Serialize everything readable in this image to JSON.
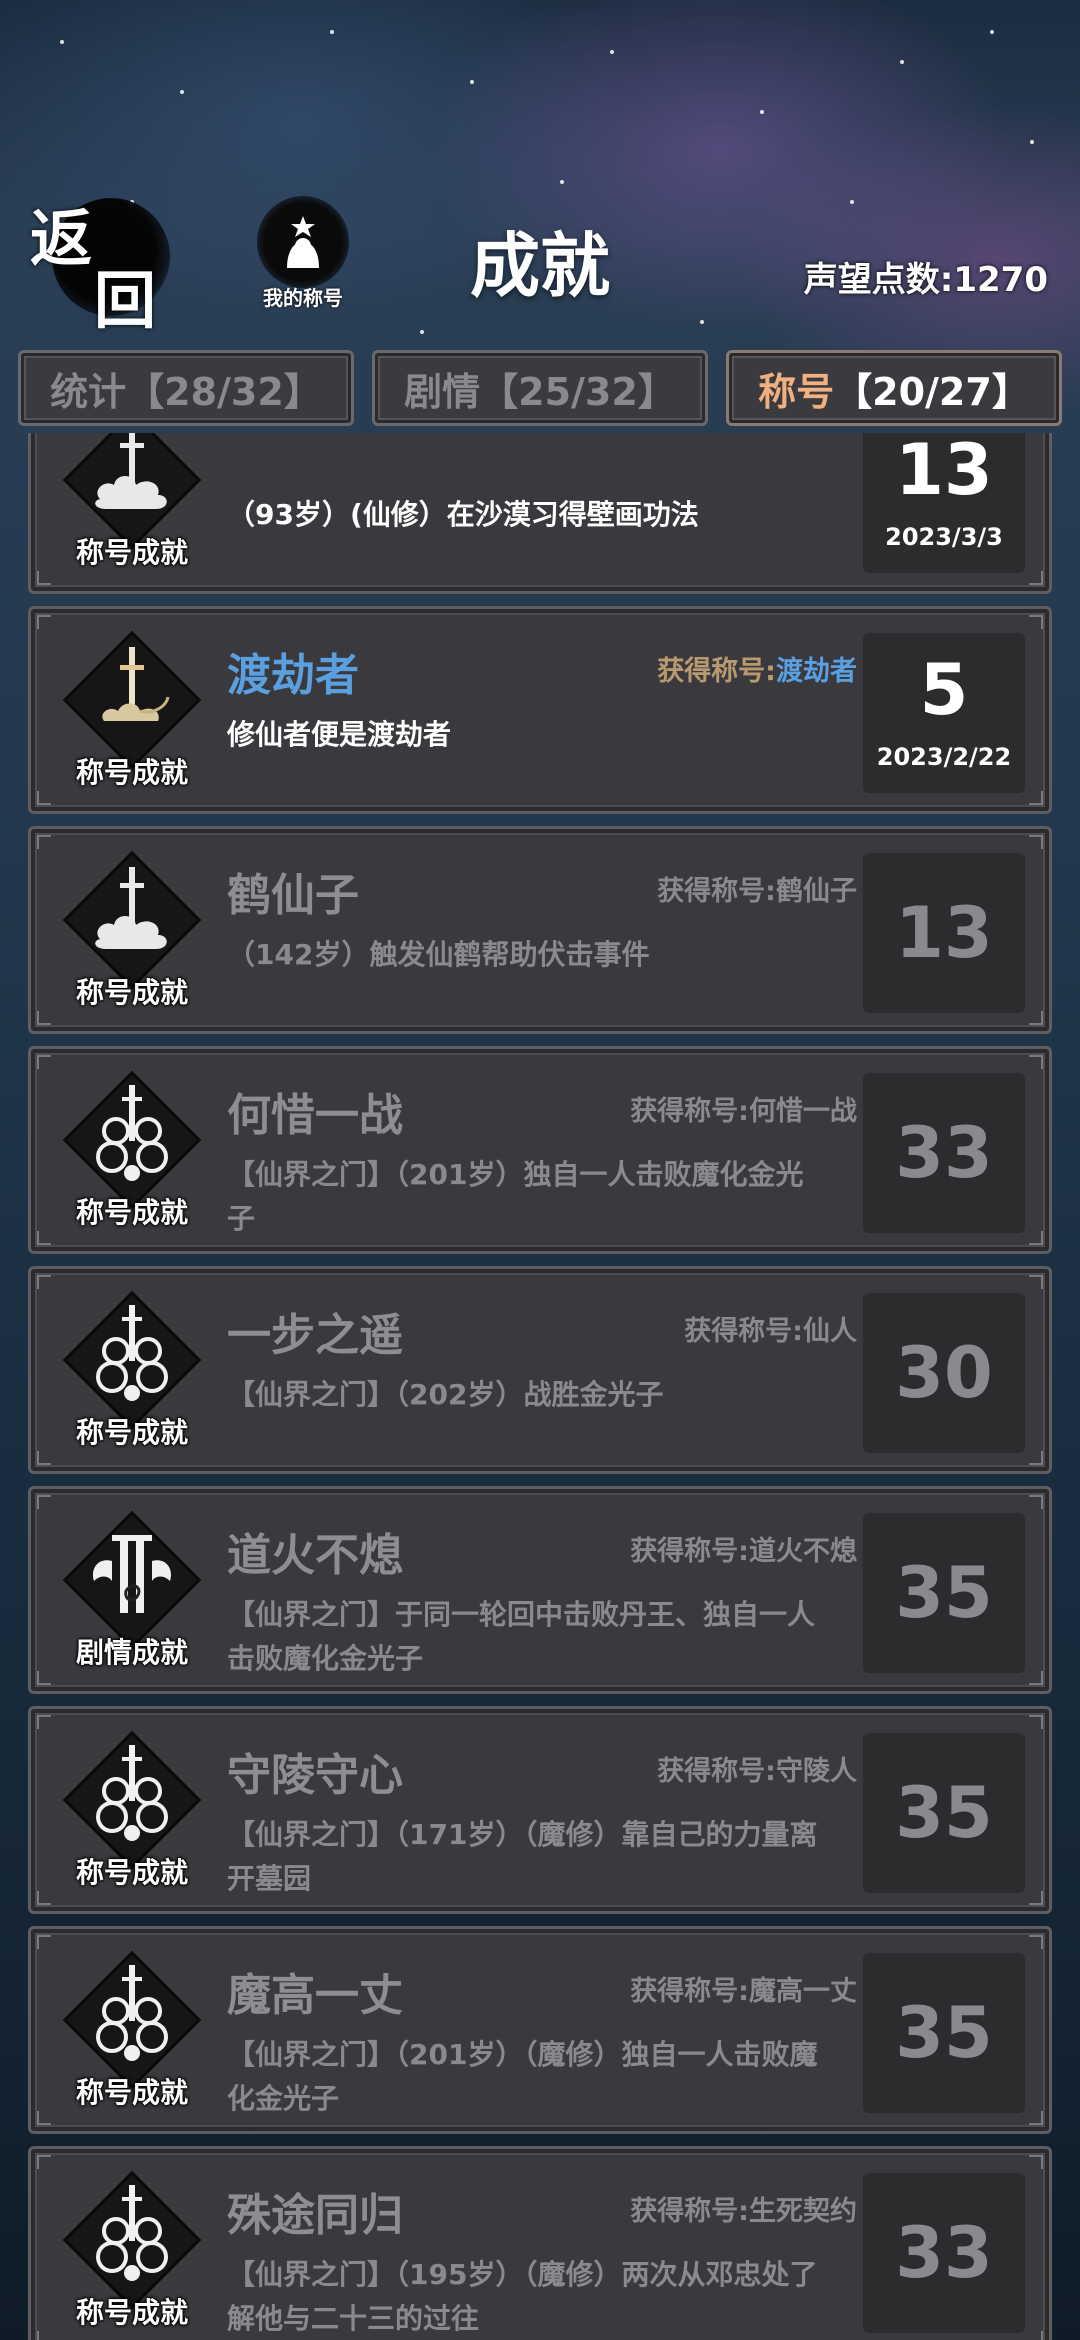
{
  "header": {
    "back_label_line1": "返",
    "back_label_line2": "回",
    "my_title_label": "我的称号",
    "page_title": "成就",
    "reputation": "声望点数:1270"
  },
  "tabs": [
    {
      "label": "统计",
      "count": "【28/32】",
      "active": false
    },
    {
      "label": "剧情",
      "count": "【25/32】",
      "active": false
    },
    {
      "label": "称号",
      "count": "【20/27】",
      "active": true
    }
  ],
  "achievements": [
    {
      "type_label": "称号成就",
      "icon": "cloud-sword-icon",
      "name": "",
      "reward_prefix": "",
      "reward_name": "",
      "desc": "（93岁）(仙修）在沙漠习得壁画功法",
      "points": "13",
      "date": "2023/3/3",
      "unlocked": true
    },
    {
      "type_label": "称号成就",
      "icon": "golden-sword-icon",
      "name": "渡劫者",
      "reward_prefix": "获得称号:",
      "reward_name": "渡劫者",
      "desc": "修仙者便是渡劫者",
      "points": "5",
      "date": "2023/2/22",
      "unlocked": true
    },
    {
      "type_label": "称号成就",
      "icon": "cloud-sword-icon",
      "name": "鹤仙子",
      "reward_prefix": "获得称号:",
      "reward_name": "鹤仙子",
      "desc": "（142岁）触发仙鹤帮助伏击事件",
      "points": "13",
      "date": "",
      "unlocked": false
    },
    {
      "type_label": "称号成就",
      "icon": "swirl-sword-icon",
      "name": "何惜一战",
      "reward_prefix": "获得称号:",
      "reward_name": "何惜一战",
      "desc": "【仙界之门】（201岁）独自一人击败魔化金光子",
      "points": "33",
      "date": "",
      "unlocked": false
    },
    {
      "type_label": "称号成就",
      "icon": "swirl-sword-icon",
      "name": "一步之遥",
      "reward_prefix": "获得称号:",
      "reward_name": "仙人",
      "desc": "【仙界之门】（202岁）战胜金光子",
      "points": "30",
      "date": "",
      "unlocked": false
    },
    {
      "type_label": "剧情成就",
      "icon": "winged-pillar-icon",
      "name": "道火不熄",
      "reward_prefix": "获得称号:",
      "reward_name": "道火不熄",
      "desc": "【仙界之门】于同一轮回中击败丹王、独自一人击败魔化金光子",
      "points": "35",
      "date": "",
      "unlocked": false
    },
    {
      "type_label": "称号成就",
      "icon": "swirl-sword-icon",
      "name": "守陵守心",
      "reward_prefix": "获得称号:",
      "reward_name": "守陵人",
      "desc": "【仙界之门】（171岁）（魔修）靠自己的力量离开墓园",
      "points": "35",
      "date": "",
      "unlocked": false
    },
    {
      "type_label": "称号成就",
      "icon": "swirl-sword-icon",
      "name": "魔高一丈",
      "reward_prefix": "获得称号:",
      "reward_name": "魔高一丈",
      "desc": "【仙界之门】（201岁）（魔修）独自一人击败魔化金光子",
      "points": "35",
      "date": "",
      "unlocked": false
    },
    {
      "type_label": "称号成就",
      "icon": "swirl-sword-icon",
      "name": "殊途同归",
      "reward_prefix": "获得称号:",
      "reward_name": "生死契约",
      "desc": "【仙界之门】（195岁）（魔修）两次从邓忠处了解他与二十三的过往",
      "points": "33",
      "date": "",
      "unlocked": false
    }
  ]
}
